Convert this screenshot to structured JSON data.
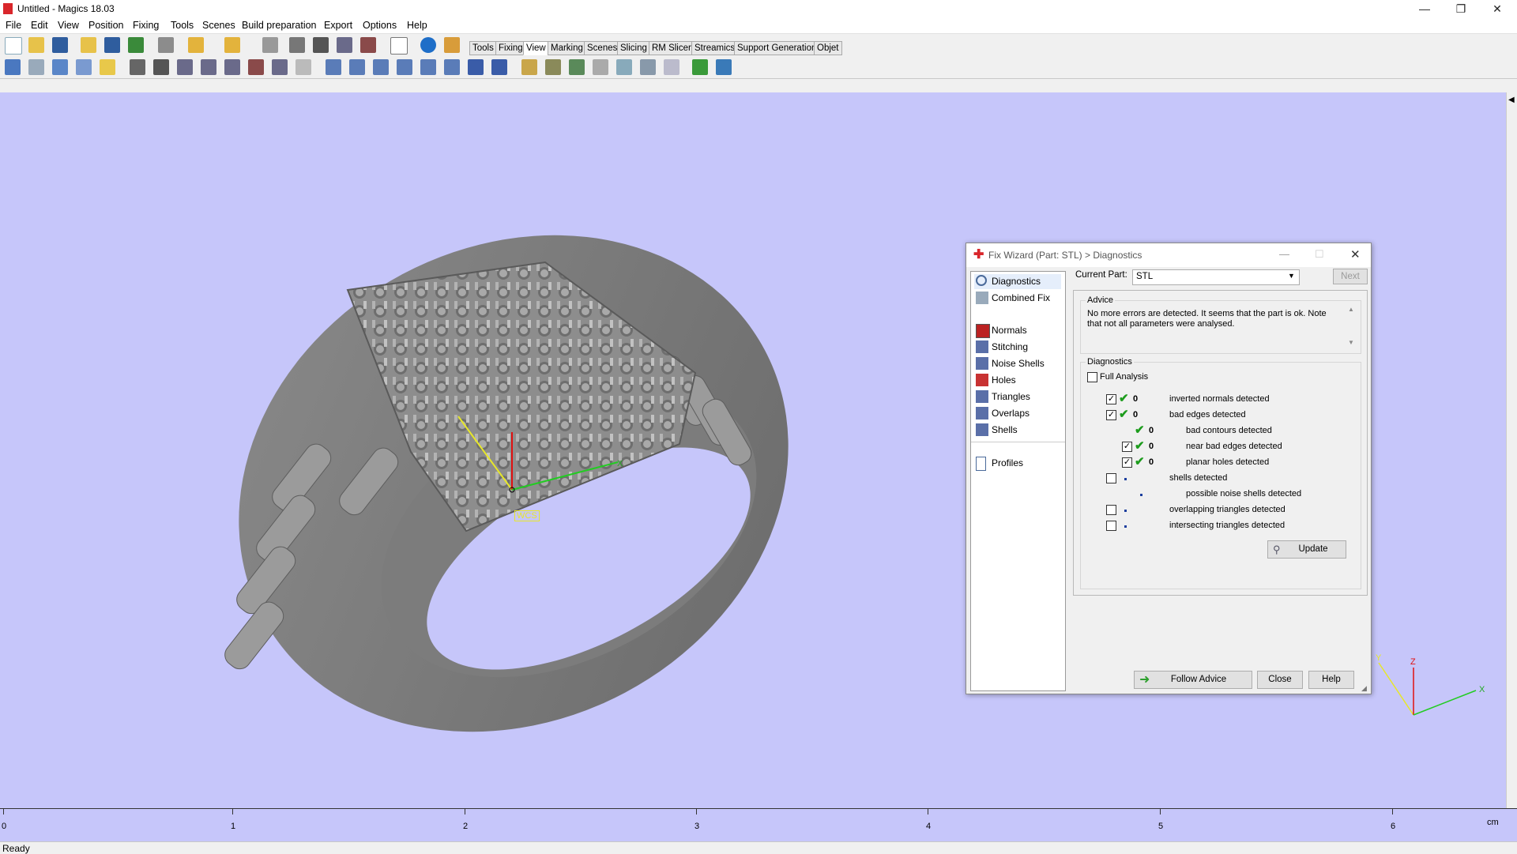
{
  "window": {
    "title": "Untitled - Magics 18.03",
    "minimize": "—",
    "restore": "❐",
    "close": "✕"
  },
  "menu": [
    "File",
    "Edit",
    "View",
    "Position",
    "Fixing",
    "Tools",
    "Scenes",
    "Build preparation",
    "Export",
    "Options",
    "Help"
  ],
  "toolbar": {
    "tabs": [
      "Tools",
      "Fixing",
      "View",
      "Marking",
      "Scenes",
      "Slicing",
      "RM Slicer",
      "Streamics",
      "Support Generation",
      "Objet"
    ],
    "active_tab": "View"
  },
  "viewport": {
    "background": "#c6c6fa",
    "wcs_label": "WCS",
    "axis_x": "X",
    "axis_y": "Y",
    "axis_z": "Z"
  },
  "ruler": {
    "ticks": [
      "0",
      "1",
      "2",
      "3",
      "4",
      "5",
      "6"
    ],
    "unit": "cm"
  },
  "status": "Ready",
  "dialog": {
    "title": "Fix Wizard (Part: STL) > Diagnostics",
    "nav": {
      "top": [
        "Diagnostics",
        "Combined Fix"
      ],
      "tools": [
        "Normals",
        "Stitching",
        "Noise Shells",
        "Holes",
        "Triangles",
        "Overlaps",
        "Shells"
      ],
      "bottom": [
        "Profiles"
      ]
    },
    "current_part_label": "Current Part:",
    "current_part": "STL",
    "next_label": "Next",
    "advice_title": "Advice",
    "advice_text": "No more errors are detected. It seems that the part is ok. Note that not all parameters were analysed.",
    "diagnostics_title": "Diagnostics",
    "full_analysis": "Full Analysis",
    "rows": [
      {
        "label": "inverted normals detected",
        "count": "0"
      },
      {
        "label": "bad edges detected",
        "count": "0"
      },
      {
        "label": "bad contours detected",
        "count": "0"
      },
      {
        "label": "near bad edges detected",
        "count": "0"
      },
      {
        "label": "planar holes detected",
        "count": "0"
      },
      {
        "label": "shells detected",
        "count": ""
      },
      {
        "label": "possible noise shells detected",
        "count": ""
      },
      {
        "label": "overlapping triangles detected",
        "count": ""
      },
      {
        "label": "intersecting triangles detected",
        "count": ""
      }
    ],
    "update": "Update",
    "follow_advice": "Follow Advice",
    "close": "Close",
    "help": "Help"
  }
}
